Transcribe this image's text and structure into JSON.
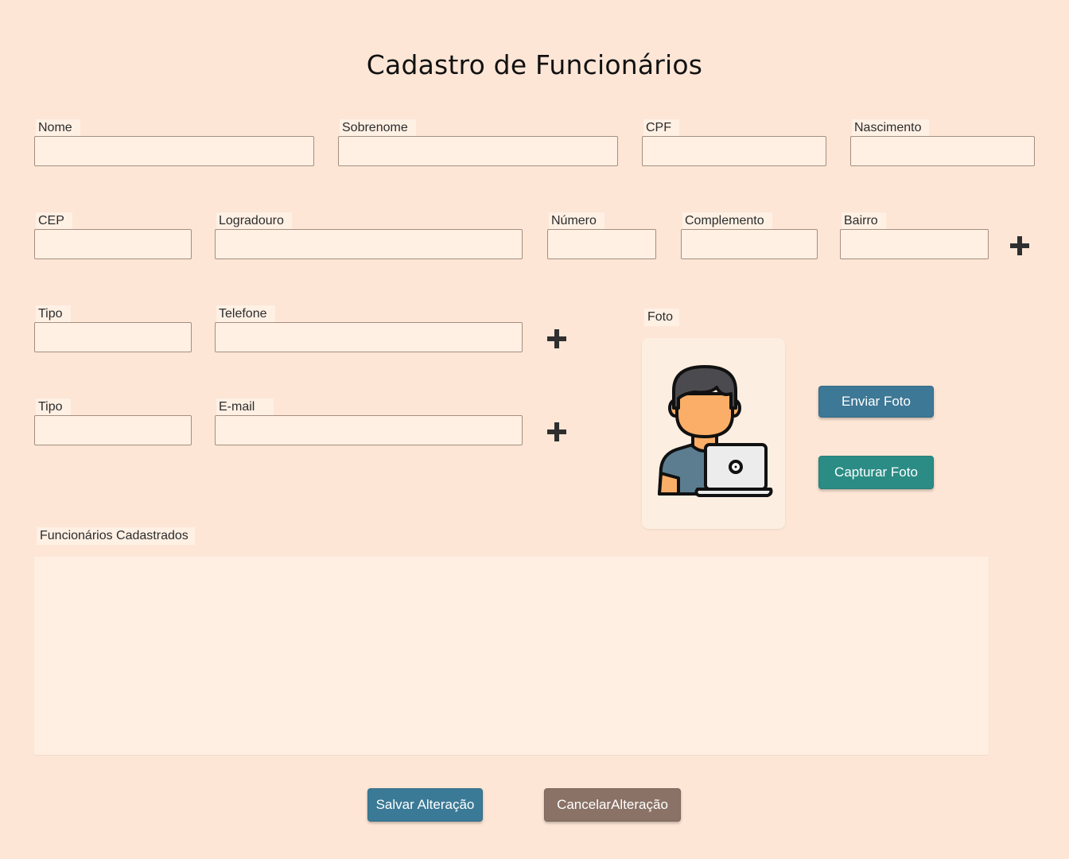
{
  "form": {
    "title": "Cadastro de Funcionários",
    "row1": {
      "nome_label": "Nome",
      "sobrenome_label": "Sobrenome",
      "cpf_label": "CPF",
      "nascimento_label": "Nascimento"
    },
    "row2": {
      "cep_label": "CEP",
      "logradouro_label": "Logradouro",
      "numero_label": "Número",
      "complemento_label": "Complemento",
      "bairro_label": "Bairro"
    },
    "phone": {
      "tipo_label": "Tipo",
      "telefone_label": "Telefone"
    },
    "email": {
      "tipo_label": "Tipo",
      "email_label": "E-mail"
    },
    "photo": {
      "label": "Foto",
      "send_button": "Enviar Foto",
      "capture_button": "Capturar Foto",
      "placeholder_icon": "user-with-laptop-icon"
    },
    "list": {
      "label": "Funcionários Cadastrados",
      "rows": []
    },
    "actions": {
      "save_button": "Salvar Alteração",
      "cancel_button": "CancelarAlteração"
    },
    "add_icon": "plus-icon"
  },
  "colors": {
    "background": "#fde6d6",
    "input_background": "#fff0e3",
    "send_button": "#3d7896",
    "capture_button": "#2a8c85",
    "save_button": "#3b7a96",
    "cancel_button": "#8a7266"
  }
}
